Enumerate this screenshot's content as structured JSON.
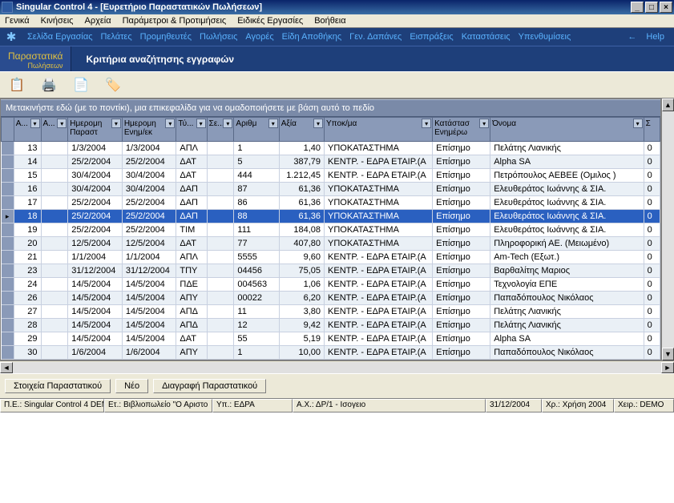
{
  "window": {
    "title": "Singular Control 4 - [Ευρετήριο Παραστατικών Πωλήσεων]"
  },
  "menu": {
    "items": [
      "Γενικά",
      "Κινήσεις",
      "Αρχεία",
      "Παράμετροι & Προτιμήσεις",
      "Ειδικές Εργασίες",
      "Βοήθεια"
    ]
  },
  "submenu": {
    "items": [
      "Σελίδα Εργασίας",
      "Πελάτες",
      "Προμηθευτές",
      "Πωλήσεις",
      "Αγορές",
      "Είδη Αποθήκης",
      "Γεν. Δαπάνες",
      "Εισπράξεις",
      "Καταστάσεις",
      "Υπενθυμίσεις"
    ],
    "help": "Help"
  },
  "section": {
    "left1": "Παραστατικά",
    "left2": "Πωλήσεων",
    "title": "Κριτήρια αναζήτησης εγγραφών"
  },
  "toolbar_icons": [
    "copy-icon",
    "print-icon",
    "preview-icon",
    "tag-icon"
  ],
  "group_hint": "Μετακινήστε εδώ (με το ποντίκι), μια επικεφαλίδα για να ομαδοποιήσετε με βάση αυτό το πεδίο",
  "columns": [
    "Α...",
    "Α...",
    "Ημερομη Παραστ",
    "Ημερομη Ενημ/εκ",
    "Τύ...",
    "Σε...",
    "Αριθμ",
    "Αξία",
    "Υποκ/μα",
    "Κατάστασ Ενημέρω",
    "Όνομα",
    "Σ"
  ],
  "rows": [
    {
      "ind": "",
      "c0": "13",
      "c1": "",
      "d1": "1/3/2004",
      "d2": "1/3/2004",
      "typ": "ΑΠΛ",
      "se": "",
      "num": "1",
      "val": "1,40",
      "sub": "ΥΠΟΚΑΤΑΣΤΗΜΑ",
      "stat": "Επίσημο",
      "name": "Πελάτης Λιανικής",
      "s": "0"
    },
    {
      "ind": "",
      "c0": "14",
      "c1": "",
      "d1": "25/2/2004",
      "d2": "25/2/2004",
      "typ": "ΔΑΤ",
      "se": "",
      "num": "5",
      "val": "387,79",
      "sub": "ΚΕΝΤΡ. - ΕΔΡΑ ΕΤΑΙΡ.(Α",
      "stat": "Επίσημο",
      "name": "Alpha SA",
      "s": "0"
    },
    {
      "ind": "",
      "c0": "15",
      "c1": "",
      "d1": "30/4/2004",
      "d2": "30/4/2004",
      "typ": "ΔΑΤ",
      "se": "",
      "num": "444",
      "val": "1.212,45",
      "sub": "ΚΕΝΤΡ. - ΕΔΡΑ ΕΤΑΙΡ.(Α",
      "stat": "Επίσημο",
      "name": "Πετρόπουλος ΑΕΒΕΕ (Ομιλος  )",
      "s": "0"
    },
    {
      "ind": "",
      "c0": "16",
      "c1": "",
      "d1": "30/4/2004",
      "d2": "30/4/2004",
      "typ": "ΔΑΠ",
      "se": "",
      "num": "87",
      "val": "61,36",
      "sub": "ΥΠΟΚΑΤΑΣΤΗΜΑ",
      "stat": "Επίσημο",
      "name": "Ελευθεράτος Ιωάννης & ΣΙΑ.",
      "s": "0"
    },
    {
      "ind": "",
      "c0": "17",
      "c1": "",
      "d1": "25/2/2004",
      "d2": "25/2/2004",
      "typ": "ΔΑΠ",
      "se": "",
      "num": "86",
      "val": "61,36",
      "sub": "ΥΠΟΚΑΤΑΣΤΗΜΑ",
      "stat": "Επίσημο",
      "name": "Ελευθεράτος Ιωάννης & ΣΙΑ.",
      "s": "0"
    },
    {
      "ind": "▸",
      "c0": "18",
      "c1": "",
      "d1": "25/2/2004",
      "d2": "25/2/2004",
      "typ": "ΔΑΠ",
      "se": "",
      "num": "88",
      "val": "61,36",
      "sub": "ΥΠΟΚΑΤΑΣΤΗΜΑ",
      "stat": "Επίσημο",
      "name": "Ελευθεράτος Ιωάννης & ΣΙΑ.",
      "s": "0",
      "selected": true
    },
    {
      "ind": "",
      "c0": "19",
      "c1": "",
      "d1": "25/2/2004",
      "d2": "25/2/2004",
      "typ": "ΤΙΜ",
      "se": "",
      "num": "111",
      "val": "184,08",
      "sub": "ΥΠΟΚΑΤΑΣΤΗΜΑ",
      "stat": "Επίσημο",
      "name": "Ελευθεράτος Ιωάννης & ΣΙΑ.",
      "s": "0"
    },
    {
      "ind": "",
      "c0": "20",
      "c1": "",
      "d1": "12/5/2004",
      "d2": "12/5/2004",
      "typ": "ΔΑΤ",
      "se": "",
      "num": "77",
      "val": "407,80",
      "sub": "ΥΠΟΚΑΤΑΣΤΗΜΑ",
      "stat": "Επίσημο",
      "name": " Πληροφορική ΑΕ. (Μειωμένο)",
      "s": "0"
    },
    {
      "ind": "",
      "c0": "21",
      "c1": "",
      "d1": "1/1/2004",
      "d2": "1/1/2004",
      "typ": "ΑΠΛ",
      "se": "",
      "num": "5555",
      "val": "9,60",
      "sub": "ΚΕΝΤΡ. - ΕΔΡΑ ΕΤΑΙΡ.(Α",
      "stat": "Επίσημο",
      "name": "Am-Tech (Εξωτ.)",
      "s": "0"
    },
    {
      "ind": "",
      "c0": "23",
      "c1": "",
      "d1": "31/12/2004",
      "d2": "31/12/2004",
      "typ": "ΤΠΥ",
      "se": "",
      "num": "04456",
      "val": "75,05",
      "sub": "ΚΕΝΤΡ. - ΕΔΡΑ ΕΤΑΙΡ.(Α",
      "stat": "Επίσημο",
      "name": "Βαρθαλίτης Μαριος",
      "s": "0"
    },
    {
      "ind": "",
      "c0": "24",
      "c1": "",
      "d1": "14/5/2004",
      "d2": "14/5/2004",
      "typ": "ΠΔΕ",
      "se": "",
      "num": "004563",
      "val": "1,06",
      "sub": "ΚΕΝΤΡ. - ΕΔΡΑ ΕΤΑΙΡ.(Α",
      "stat": "Επίσημο",
      "name": "Τεχνολογία ΕΠΕ",
      "s": "0"
    },
    {
      "ind": "",
      "c0": "26",
      "c1": "",
      "d1": "14/5/2004",
      "d2": "14/5/2004",
      "typ": "ΑΠΥ",
      "se": "",
      "num": "00022",
      "val": "6,20",
      "sub": "ΚΕΝΤΡ. - ΕΔΡΑ ΕΤΑΙΡ.(Α",
      "stat": "Επίσημο",
      "name": "Παπαδόπουλος Νικόλαος",
      "s": "0"
    },
    {
      "ind": "",
      "c0": "27",
      "c1": "",
      "d1": "14/5/2004",
      "d2": "14/5/2004",
      "typ": "ΑΠΔ",
      "se": "",
      "num": "11",
      "val": "3,80",
      "sub": "ΚΕΝΤΡ. - ΕΔΡΑ ΕΤΑΙΡ.(Α",
      "stat": "Επίσημο",
      "name": "Πελάτης Λιανικής",
      "s": "0"
    },
    {
      "ind": "",
      "c0": "28",
      "c1": "",
      "d1": "14/5/2004",
      "d2": "14/5/2004",
      "typ": "ΑΠΔ",
      "se": "",
      "num": "12",
      "val": "9,42",
      "sub": "ΚΕΝΤΡ. - ΕΔΡΑ ΕΤΑΙΡ.(Α",
      "stat": "Επίσημο",
      "name": "Πελάτης Λιανικής",
      "s": "0"
    },
    {
      "ind": "",
      "c0": "29",
      "c1": "",
      "d1": "14/5/2004",
      "d2": "14/5/2004",
      "typ": "ΔΑΤ",
      "se": "",
      "num": "55",
      "val": "5,19",
      "sub": "ΚΕΝΤΡ. - ΕΔΡΑ ΕΤΑΙΡ.(Α",
      "stat": "Επίσημο",
      "name": "Alpha SA",
      "s": "0"
    },
    {
      "ind": "",
      "c0": "30",
      "c1": "",
      "d1": "1/6/2004",
      "d2": "1/6/2004",
      "typ": "ΑΠΥ",
      "se": "",
      "num": "1",
      "val": "10,00",
      "sub": "ΚΕΝΤΡ. - ΕΔΡΑ ΕΤΑΙΡ.(Α",
      "stat": "Επίσημο",
      "name": "Παπαδόπουλος Νικόλαος",
      "s": "0"
    }
  ],
  "bottom_buttons": {
    "details": "Στοιχεία Παραστατικού",
    "new": "Νέο",
    "delete": "Διαγραφή Παραστατικού"
  },
  "status": {
    "pe": "Π.Ε.: Singular Control 4 DEM",
    "et": "Ετ.: Βιβλιοπωλείο \"Ο Αριστο",
    "yp": "Υπ.: ΕΔΡΑ",
    "ax": "Α.Χ.: ΔΡ/1 - Ισογειο",
    "date": "31/12/2004",
    "xr": "Χρ.: Χρήση 2004",
    "xeir": "Χειρ.: DEMO"
  }
}
